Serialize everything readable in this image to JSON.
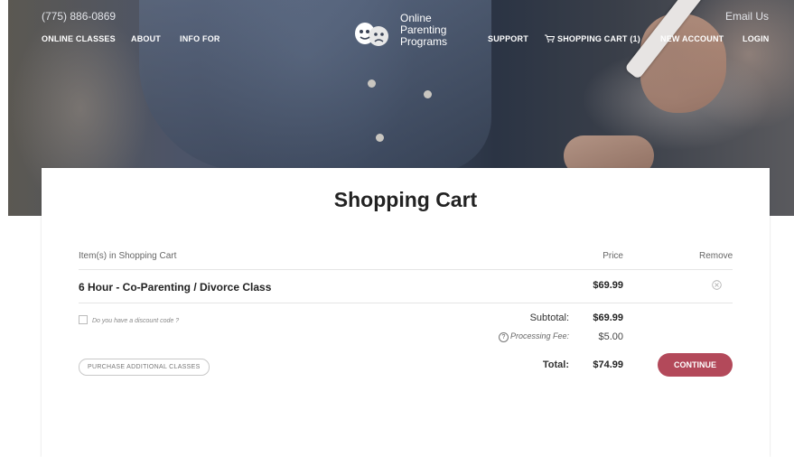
{
  "header": {
    "phone": "(775) 886-0869",
    "email_link": "Email Us",
    "logo_text": [
      "Online",
      "Parenting",
      "Programs"
    ],
    "nav": {
      "online_classes": "ONLINE CLASSES",
      "about": "ABOUT",
      "info_for": "INFO FOR",
      "support": "SUPPORT",
      "shopping_cart": "SHOPPING CART",
      "cart_count": "(1)",
      "new_account": "NEW ACCOUNT",
      "login": "LOGIN"
    }
  },
  "cart": {
    "title": "Shopping Cart",
    "columns": {
      "items": "Item(s) in Shopping Cart",
      "price": "Price",
      "remove": "Remove"
    },
    "items": [
      {
        "name": "6 Hour - Co-Parenting / Divorce Class",
        "price": "$69.99"
      }
    ],
    "discount_prompt": "Do you have a discount code ?",
    "subtotal_label": "Subtotal:",
    "subtotal_value": "$69.99",
    "fee_label": "Processing Fee:",
    "fee_value": "$5.00",
    "total_label": "Total:",
    "total_value": "$74.99",
    "purchase_additional": "PURCHASE ADDITIONAL CLASSES",
    "continue": "CONTINUE"
  },
  "colors": {
    "continue_button": "#b3495a",
    "nav_text": "#ffffff"
  }
}
